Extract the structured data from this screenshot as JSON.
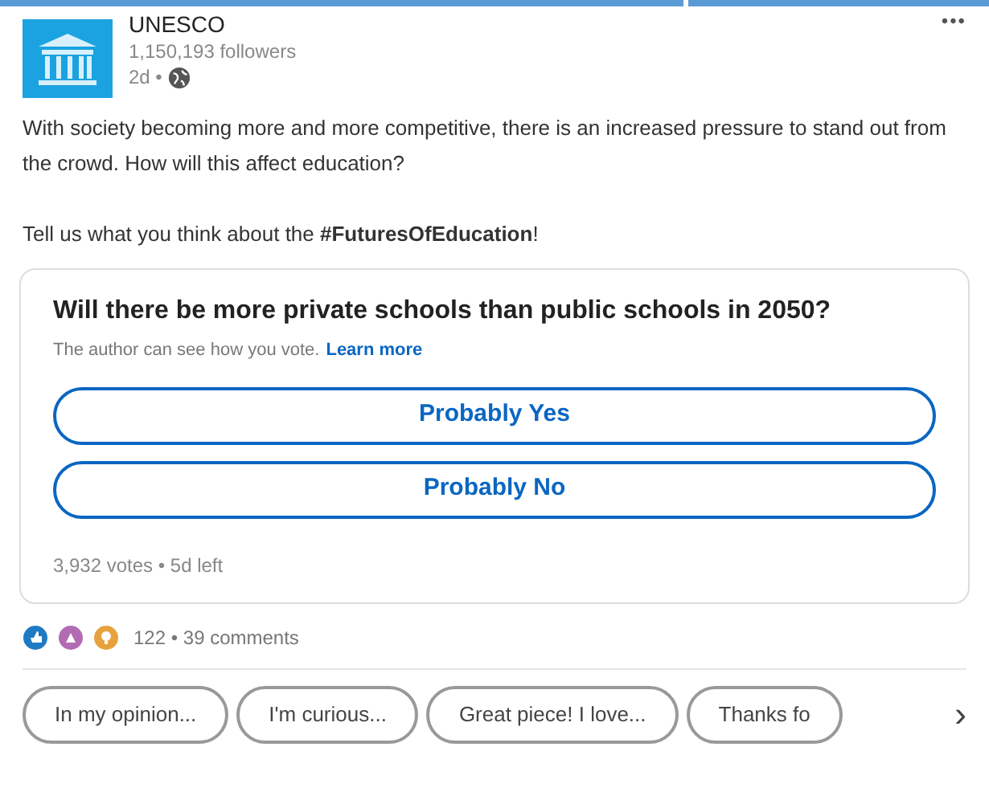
{
  "author": {
    "name": "UNESCO",
    "followers": "1,150,193 followers",
    "age": "2d •"
  },
  "menu": "•••",
  "body": [
    "With society becoming more and more competitive, there is an increased pressure to stand out from the crowd. How will this affect education?",
    "Tell us what you think about the **#FuturesOfEducation**!"
  ],
  "poll": {
    "question": "Will there be more private schools than public schools in 2050?",
    "note": "The author can see how you vote.",
    "note_link": "Learn more",
    "options": [
      "Probably Yes",
      "Probably No"
    ],
    "footer": "3,932 votes • 5d left"
  },
  "social": {
    "reactions": [
      {
        "kind": "like",
        "color": "#1f7ac4"
      },
      {
        "kind": "celebrate",
        "color": "#b36bb3"
      },
      {
        "kind": "insightful",
        "color": "#e6a23c"
      }
    ],
    "summary": "122 • 39 comments"
  },
  "suggestions": [
    "In my opinion...",
    "I'm curious...",
    "Great piece! I love...",
    "Thanks fo"
  ],
  "next": "›"
}
